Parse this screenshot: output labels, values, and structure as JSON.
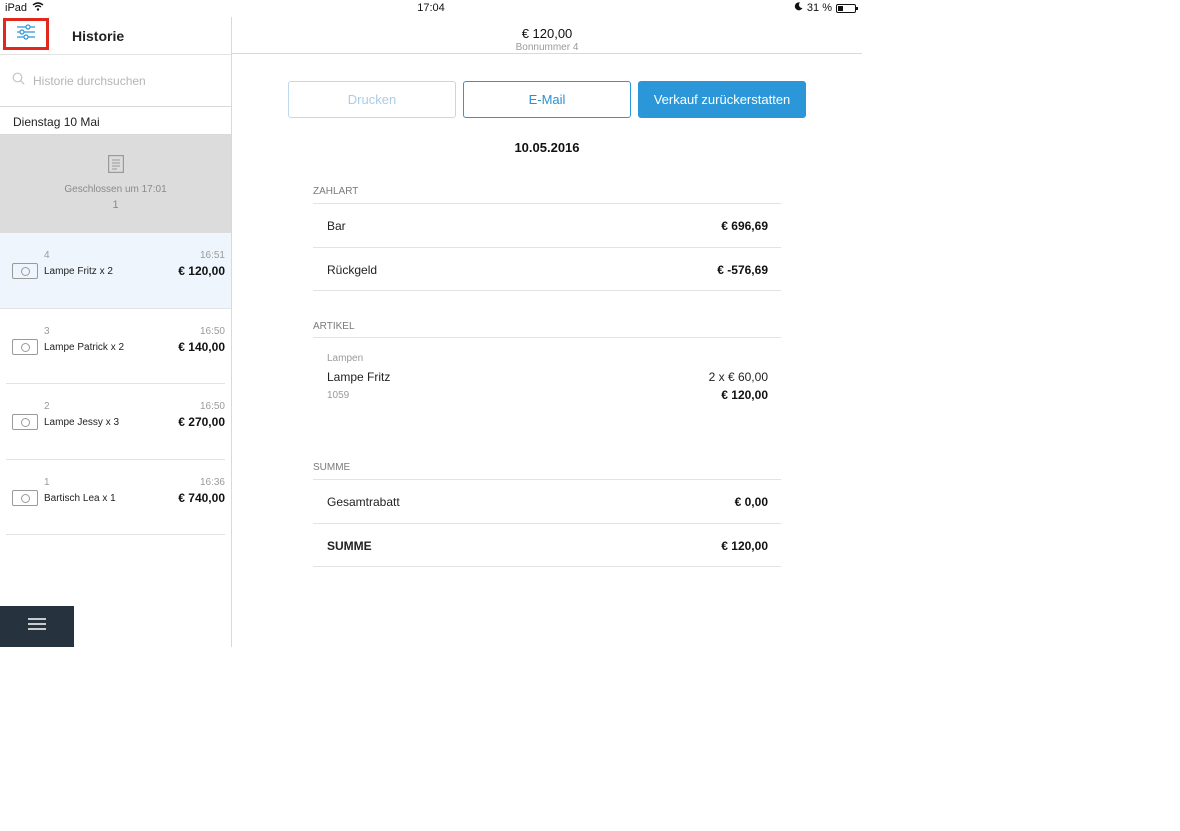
{
  "status_bar": {
    "device": "iPad",
    "time": "17:04",
    "battery": "31 %",
    "battery_level": 0.31
  },
  "left_panel": {
    "title": "Historie",
    "search_placeholder": "Historie durchsuchen",
    "day_header": "Dienstag 10 Mai",
    "closed_block": {
      "label": "Geschlossen um 17:01",
      "count": "1"
    },
    "receipts": [
      {
        "number": "4",
        "time": "16:51",
        "title": "Lampe Fritz x 2",
        "amount": "€ 120,00"
      },
      {
        "number": "3",
        "time": "16:50",
        "title": "Lampe Patrick x 2",
        "amount": "€ 140,00"
      },
      {
        "number": "2",
        "time": "16:50",
        "title": "Lampe Jessy x 3",
        "amount": "€ 270,00"
      },
      {
        "number": "1",
        "time": "16:36",
        "title": "Bartisch Lea x 1",
        "amount": "€ 740,00"
      }
    ]
  },
  "right_panel": {
    "header_amount": "€ 120,00",
    "header_subtitle": "Bonnummer 4",
    "buttons": {
      "print": "Drucken",
      "email": "E-Mail",
      "refund": "Verkauf zurückerstatten"
    },
    "date": "10.05.2016",
    "payment": {
      "label": "ZAHLART",
      "rows": [
        {
          "label": "Bar",
          "value": "€ 696,69"
        },
        {
          "label": "Rückgeld",
          "value": "€ -576,69"
        }
      ]
    },
    "articles": {
      "label": "ARTIKEL",
      "item": {
        "category": "Lampen",
        "name": "Lampe Fritz",
        "sku": "1059",
        "qty_price": "2 x € 60,00",
        "total": "€ 120,00"
      }
    },
    "sum": {
      "label": "SUMME",
      "rows": [
        {
          "label": "Gesamtrabatt",
          "value": "€ 0,00"
        },
        {
          "label": "SUMME",
          "value": "€ 120,00"
        }
      ]
    }
  },
  "colors": {
    "accent": "#2b97d8",
    "highlight_border": "#e0281c",
    "selected_row": "#eef5fc",
    "closed_block": "#dcdcdc",
    "menu_bar": "#27323f"
  }
}
